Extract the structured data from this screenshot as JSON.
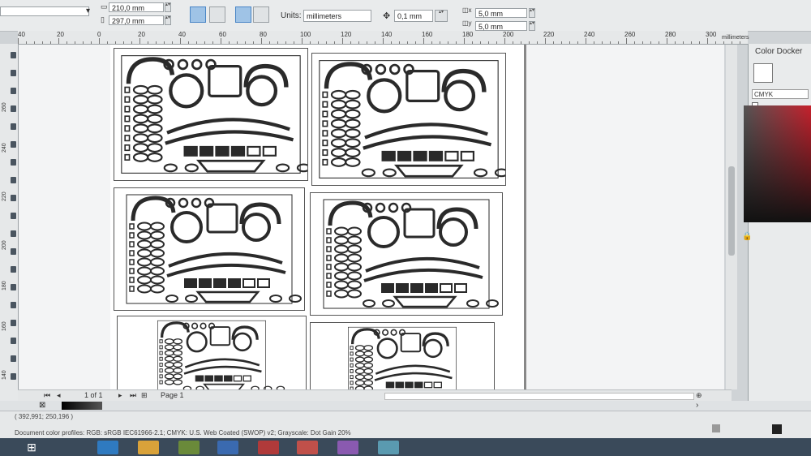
{
  "propbar": {
    "width": "210,0 mm",
    "height": "297,0 mm",
    "units_label": "Units:",
    "units_value": "millimeters",
    "nudge": "0,1 mm",
    "dup_x": "5,0 mm",
    "dup_y": "5,0 mm"
  },
  "ruler": {
    "h_ticks": [
      "40",
      "20",
      "0",
      "20",
      "40",
      "60",
      "80",
      "100",
      "120",
      "140",
      "160",
      "180",
      "200",
      "220",
      "240",
      "260",
      "280",
      "300"
    ],
    "h_units": "millimeters",
    "v_ticks": [
      "260",
      "240",
      "220",
      "200",
      "180",
      "160",
      "140"
    ]
  },
  "docker": {
    "title": "Color Docker",
    "model": "CMYK"
  },
  "pagebar": {
    "page_count": "1 of 1",
    "page_tab": "Page 1"
  },
  "statusbar": {
    "coords": "( 392,991; 250,196 )",
    "profile": "Document color profiles: RGB: sRGB IEC61966-2.1; CMYK: U.S. Web Coated (SWOP) v2; Grayscale: Dot Gain 20%"
  },
  "colors": {
    "accent": "#4a86c6",
    "shape_stroke": "#2a2a2a",
    "taskbar": "#3a4a5a"
  }
}
